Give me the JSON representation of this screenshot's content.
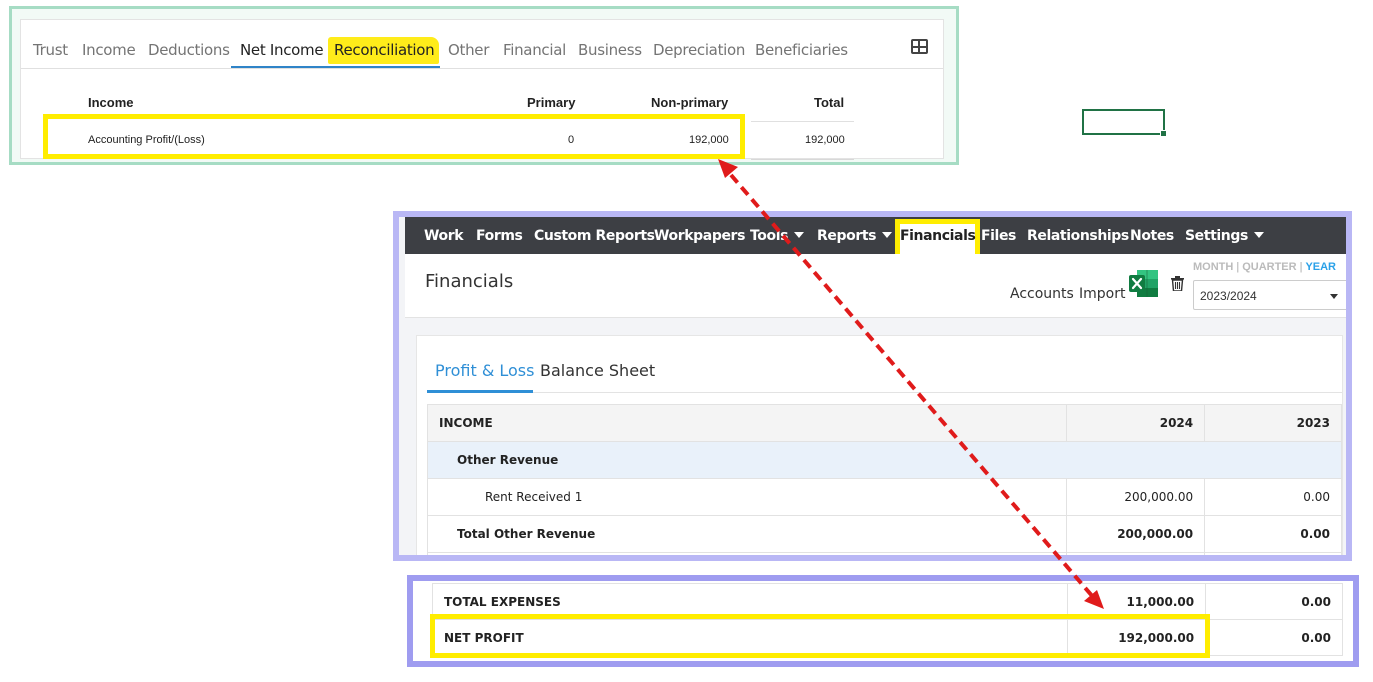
{
  "panel_top": {
    "tabs": [
      "Trust",
      "Income",
      "Deductions",
      "Net Income",
      "Reconciliation",
      "Other",
      "Financial",
      "Business",
      "Depreciation",
      "Beneficiaries"
    ],
    "active_tab": "Net Income",
    "highlighted_tab": "Reconciliation",
    "columns": [
      "Income",
      "Primary",
      "Non-primary",
      "Total"
    ],
    "row": {
      "label": "Accounting Profit/(Loss)",
      "primary": "0",
      "non_primary": "192,000",
      "total": "192,000"
    }
  },
  "app": {
    "nav": [
      "Work",
      "Forms",
      "Custom Reports",
      "Workpapers",
      "Tools",
      "Reports",
      "Financials",
      "Files",
      "Relationships",
      "Notes",
      "Settings"
    ],
    "page_title": "Financials",
    "accounts_label": "Accounts",
    "import_label": "Import",
    "period_options": [
      "MONTH",
      "QUARTER",
      "YEAR"
    ],
    "period_selected": "YEAR",
    "year_select": "2023/2024",
    "report_tabs": [
      "Profit & Loss",
      "Balance Sheet"
    ],
    "table": {
      "header": [
        "INCOME",
        "2024",
        "2023"
      ],
      "group": "Other Revenue",
      "rows": [
        {
          "label": "Rent Received 1",
          "y2024": "200,000.00",
          "y2023": "0.00"
        },
        {
          "label": "Total Other Revenue",
          "y2024": "200,000.00",
          "y2023": "0.00"
        }
      ]
    }
  },
  "summary": {
    "rows": [
      {
        "label": "TOTAL EXPENSES",
        "y2024": "11,000.00",
        "y2023": "0.00"
      },
      {
        "label": "NET PROFIT",
        "y2024": "192,000.00",
        "y2023": "0.00"
      }
    ]
  },
  "colors": {
    "highlight": "#ffed00",
    "arrow": "#e01b1b",
    "accent": "#2f8fd6",
    "navbar": "#3d3f44"
  }
}
